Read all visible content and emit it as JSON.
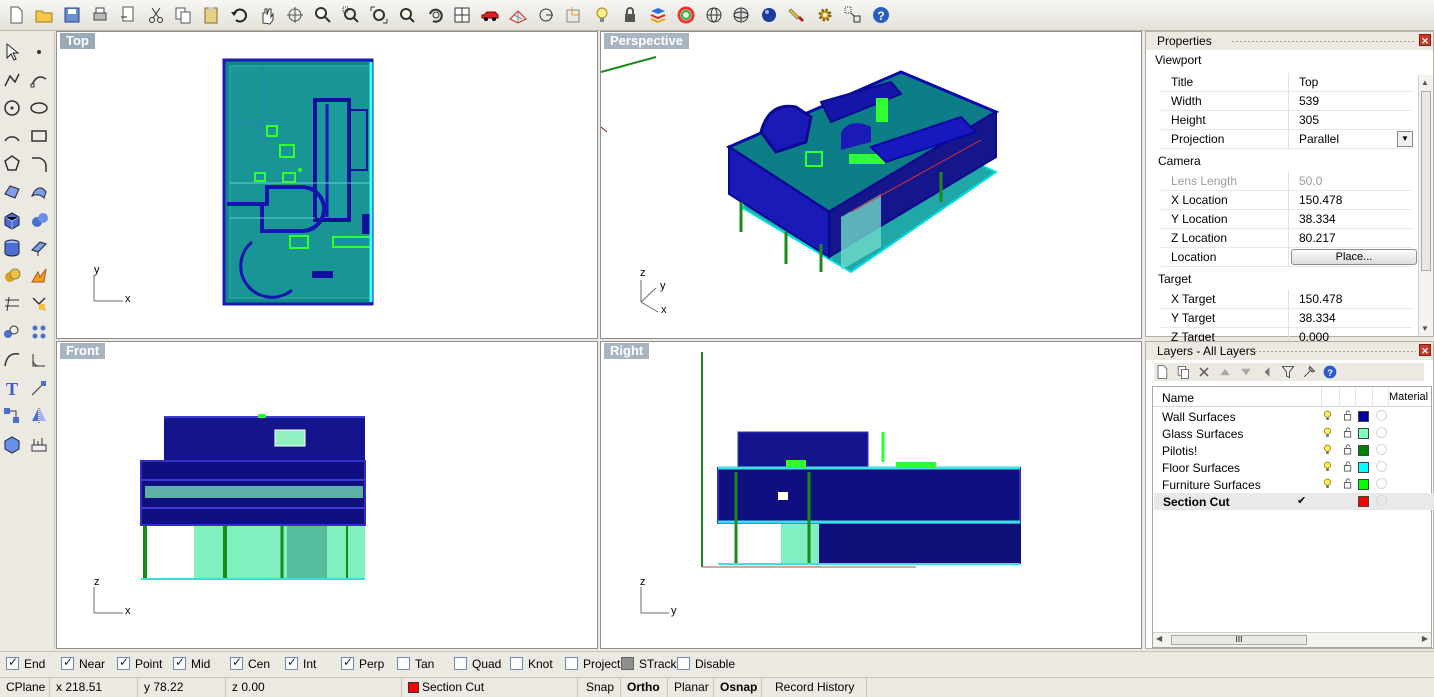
{
  "toolbar": {
    "icons": [
      "new-file-icon",
      "open-folder-icon",
      "save-icon",
      "print-icon",
      "import-icon",
      "cut-icon",
      "copy-icon",
      "paste-icon",
      "undo-icon",
      "pan-hand-icon",
      "rotate-view-icon",
      "zoom-icon",
      "zoom-window-icon",
      "zoom-extents-icon",
      "zoom-selected-icon",
      "undo-view-icon",
      "four-viewports-icon",
      "car-render-icon",
      "grid-options-icon",
      "object-snap-icon",
      "point-snap-icon",
      "light-bulb-icon",
      "lock-icon",
      "layer-color-icon",
      "color-wheel-icon",
      "sphere-wire-icon",
      "sphere-grid-icon",
      "sphere-render-icon",
      "paint-brush-icon",
      "options-gear-icon",
      "grouping-icon",
      "help-icon"
    ]
  },
  "left_tools": {
    "icons": [
      "select-arrow-icon",
      "point-icon",
      "polyline-icon",
      "curve-icon",
      "circle-icon",
      "ellipse-icon",
      "arc-icon",
      "rectangle-icon",
      "polygon-icon",
      "fillet-icon",
      "surface-icon",
      "loft-icon",
      "box-icon",
      "sphere-icon",
      "cylinder-icon",
      "extrude-icon",
      "boolean-icon",
      "blast-icon",
      "split-icon",
      "trim-icon",
      "solid-tools-icon",
      "array-icon",
      "bend-icon",
      "fillet-edge-icon",
      "text-icon",
      "dimension-icon",
      "transform-icon",
      "mirror-icon",
      "cage-icon",
      "render-icon"
    ]
  },
  "viewports": {
    "top": {
      "title": "Top",
      "axis_a": "y",
      "axis_b": "x"
    },
    "perspective": {
      "title": "Perspective",
      "axis_a": "z",
      "axis_b": "y",
      "axis_c": "x"
    },
    "front": {
      "title": "Front",
      "axis_a": "z",
      "axis_b": "x"
    },
    "right": {
      "title": "Right",
      "axis_a": "z",
      "axis_b": "y"
    }
  },
  "properties": {
    "header": "Properties",
    "section": "Viewport",
    "rows": [
      {
        "label": "Title",
        "value": "Top"
      },
      {
        "label": "Width",
        "value": "539"
      },
      {
        "label": "Height",
        "value": "305"
      },
      {
        "label": "Projection",
        "value": "Parallel"
      }
    ],
    "camera_label": "Camera",
    "camera_rows": [
      {
        "label": "Lens Length",
        "value": "50.0"
      },
      {
        "label": "X Location",
        "value": "150.478"
      },
      {
        "label": "Y Location",
        "value": "38.334"
      },
      {
        "label": "Z Location",
        "value": "80.217"
      },
      {
        "label": "Location",
        "value": "Place..."
      }
    ],
    "target_label": "Target",
    "target_rows": [
      {
        "label": "X Target",
        "value": "150.478"
      },
      {
        "label": "Y Target",
        "value": "38.334"
      },
      {
        "label": "Z Target",
        "value": "0.000"
      }
    ]
  },
  "layers": {
    "header": "Layers - All Layers",
    "tool_icons": [
      "new-layer-icon",
      "new-sublayer-icon",
      "delete-layer-icon",
      "move-up-icon",
      "move-down-icon",
      "move-parent-icon",
      "filter-icon",
      "tools-icon",
      "help-icon"
    ],
    "col_name": "Name",
    "col_material": "Material",
    "rows": [
      {
        "name": "Wall Surfaces",
        "color": "#0000a0",
        "current": false
      },
      {
        "name": "Glass Surfaces",
        "color": "#80ffc0",
        "current": false
      },
      {
        "name": "Pilotis!",
        "color": "#008000",
        "current": false
      },
      {
        "name": "Floor Surfaces",
        "color": "#00ffff",
        "current": false
      },
      {
        "name": "Furniture Surfaces",
        "color": "#00ff00",
        "current": false
      },
      {
        "name": "Section Cut",
        "color": "#ff0000",
        "current": true
      }
    ],
    "scroll_grip": "III"
  },
  "osnap": [
    {
      "label": "End",
      "checked": true
    },
    {
      "label": "Near",
      "checked": true
    },
    {
      "label": "Point",
      "checked": true
    },
    {
      "label": "Mid",
      "checked": true
    },
    {
      "label": "Cen",
      "checked": true
    },
    {
      "label": "Int",
      "checked": true
    },
    {
      "label": "Perp",
      "checked": true
    },
    {
      "label": "Tan",
      "checked": false
    },
    {
      "label": "Quad",
      "checked": false
    },
    {
      "label": "Knot",
      "checked": false
    },
    {
      "label": "Project",
      "checked": false
    },
    {
      "label": "STrack",
      "checked": false
    },
    {
      "label": "Disable",
      "checked": false
    }
  ],
  "status": {
    "cplane": "CPlane",
    "x": "x 218.51",
    "y": "y 78.22",
    "z": "z 0.00",
    "layer": "Section Cut",
    "layer_color": "#ff0000",
    "snap": "Snap",
    "ortho": "Ortho",
    "planar": "Planar",
    "osnap": "Osnap",
    "history": "Record History"
  }
}
